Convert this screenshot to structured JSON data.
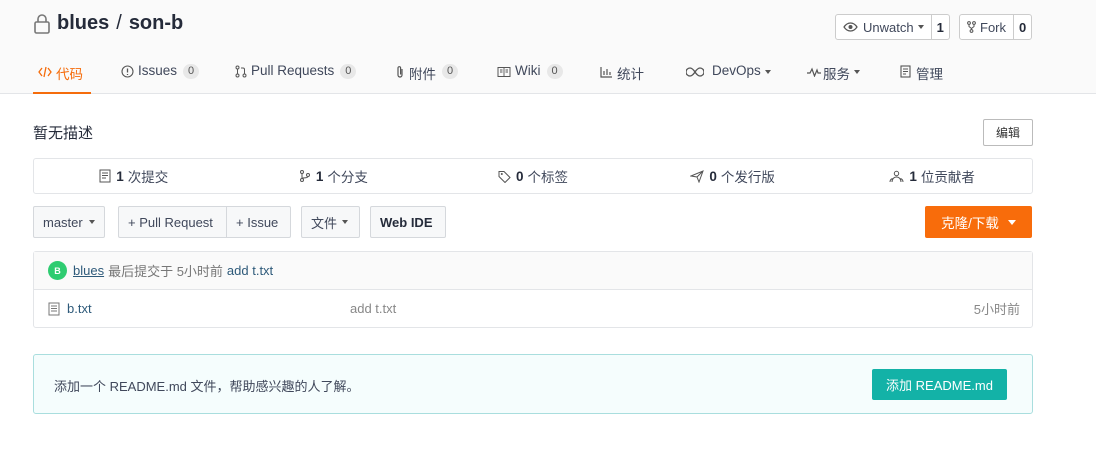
{
  "repo": {
    "owner": "blues",
    "separator": "/",
    "name": "son-b"
  },
  "watch": {
    "label": "Unwatch",
    "count": "1"
  },
  "fork": {
    "label": "Fork",
    "count": "0"
  },
  "tabs": [
    {
      "label": "代码"
    },
    {
      "label": "Issues",
      "badge": "0"
    },
    {
      "label": "Pull Requests",
      "badge": "0"
    },
    {
      "label": "附件",
      "badge": "0"
    },
    {
      "label": "Wiki",
      "badge": "0"
    },
    {
      "label": "统计"
    },
    {
      "label": "DevOps"
    },
    {
      "label": "服务"
    },
    {
      "label": "管理"
    }
  ],
  "description": "暂无描述",
  "edit_label": "编辑",
  "stats": [
    {
      "count": "1",
      "label": "次提交"
    },
    {
      "count": "1",
      "label": "个分支"
    },
    {
      "count": "0",
      "label": "个标签"
    },
    {
      "count": "0",
      "label": "个发行版"
    },
    {
      "count": "1",
      "label": "位贡献者"
    }
  ],
  "toolbar": {
    "branch": "master",
    "pull_request": "+ Pull Request",
    "issue": "+ Issue",
    "files": "文件",
    "web_ide": "Web IDE",
    "clone": "克隆/下载"
  },
  "last_commit": {
    "avatar_letter": "B",
    "author": "blues",
    "meta": "最后提交于 5小时前",
    "message": "add t.txt"
  },
  "files": [
    {
      "name": "b.txt",
      "message": "add t.txt",
      "time": "5小时前"
    }
  ],
  "readme": {
    "text": "添加一个 README.md 文件，帮助感兴趣的人了解。",
    "button": "添加 README.md"
  },
  "colors": {
    "accent": "#f86c0b",
    "teal": "#13b2a7",
    "link": "#2e5a7a"
  }
}
